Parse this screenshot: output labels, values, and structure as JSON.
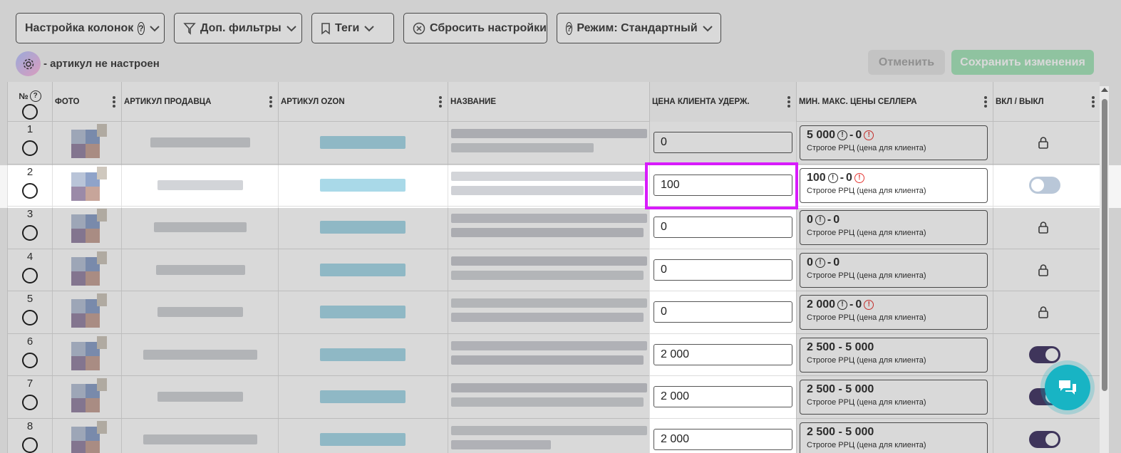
{
  "toolbar": {
    "columns_label": "Настройка колонок",
    "filters_label": "Доп. фильтры",
    "tags_label": "Теги",
    "reset_label": "Сбросить настройки",
    "mode_label": "Режим: Стандартный"
  },
  "legend": {
    "text": "- артикул не настроен"
  },
  "actions": {
    "cancel_label": "Отменить",
    "save_label": "Сохранить изменения"
  },
  "table": {
    "headers": {
      "num": "№",
      "photo": "ФОТО",
      "seller_sku": "АРТИКУЛ ПРОДАВЦА",
      "ozon_sku": "АРТИКУЛ OZON",
      "name": "НАЗВАНИЕ",
      "client_price": "ЦЕНА КЛИЕНТА УДЕРЖ.",
      "min_max": "МИН. МАКС. ЦЕНЫ СЕЛЛЕРА",
      "toggle": "ВКЛ / ВЫКЛ"
    },
    "rows": [
      {
        "num": "1",
        "price": "0",
        "min": "5 000",
        "max": "0",
        "min_warn": true,
        "max_warn": true,
        "mm_text": "",
        "note": "Строгое РРЦ (цена для клиента)",
        "state": "lock"
      },
      {
        "num": "2",
        "price": "100",
        "min": "100",
        "max": "0",
        "min_warn": true,
        "max_warn": true,
        "mm_text": "",
        "note": "Строгое РРЦ (цена для клиента)",
        "state": "off"
      },
      {
        "num": "3",
        "price": "0",
        "min": "0",
        "max": "0",
        "min_warn": true,
        "max_warn": false,
        "mm_text": "",
        "note": "Строгое РРЦ (цена для клиента)",
        "state": "lock"
      },
      {
        "num": "4",
        "price": "0",
        "min": "0",
        "max": "0",
        "min_warn": true,
        "max_warn": false,
        "mm_text": "",
        "note": "Строгое РРЦ (цена для клиента)",
        "state": "lock"
      },
      {
        "num": "5",
        "price": "0",
        "min": "2 000",
        "max": "0",
        "min_warn": true,
        "max_warn": true,
        "mm_text": "",
        "note": "Строгое РРЦ (цена для клиента)",
        "state": "lock"
      },
      {
        "num": "6",
        "price": "2 000",
        "min": "",
        "max": "",
        "min_warn": false,
        "max_warn": false,
        "mm_text": "2 500 - 5 000",
        "note": "Строгое РРЦ (цена для клиента)",
        "state": "on"
      },
      {
        "num": "7",
        "price": "2 000",
        "min": "",
        "max": "",
        "min_warn": false,
        "max_warn": false,
        "mm_text": "2 500 - 5 000",
        "note": "Строгое РРЦ (цена для клиента)",
        "state": "on"
      },
      {
        "num": "8",
        "price": "2 000",
        "min": "",
        "max": "",
        "min_warn": false,
        "max_warn": false,
        "mm_text": "2 500 - 5 000",
        "note": "Строгое РРЦ (цена для клиента)",
        "state": "on"
      }
    ]
  },
  "colors": {
    "highlight": "#d81bfb",
    "chat": "#18b4c4",
    "save": "#a9e5bd",
    "toggle_on": "#4a3f6b"
  }
}
